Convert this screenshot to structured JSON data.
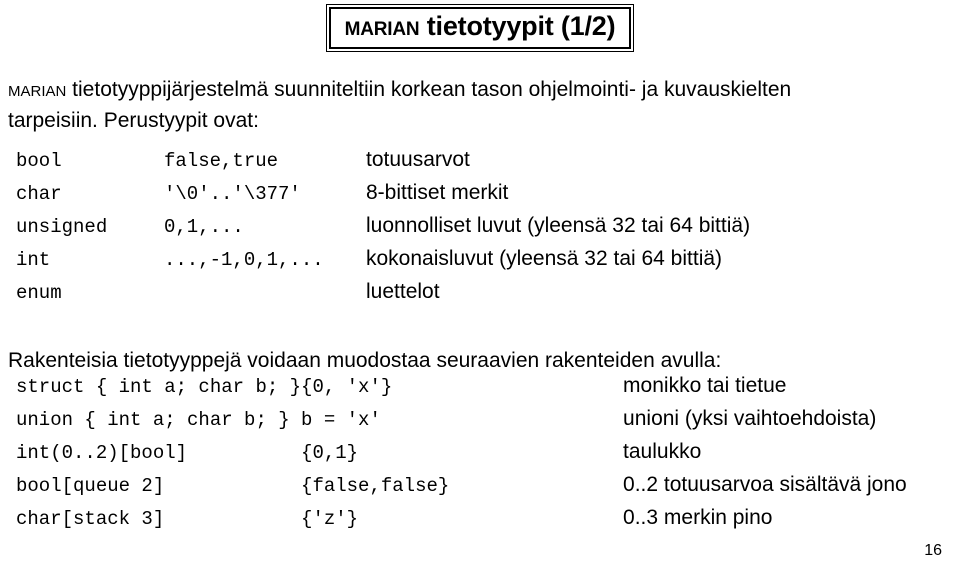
{
  "slide": {
    "title_smallcaps": "Marian",
    "title_rest": " tietotyypit (1/2)",
    "page_number": "16"
  },
  "intro": {
    "smallcaps_word": "Marian",
    "line1_rest": " tietotyyppijärjestelmä suunniteltiin korkean tason ohjelmointi- ja kuvauskielten",
    "line2": "tarpeisiin. Perustyypit ovat:"
  },
  "basic_types": {
    "rows": [
      {
        "type": "bool",
        "values": "false,true",
        "description": "totuusarvot"
      },
      {
        "type": "char",
        "values": "'\\0'..'\\377'",
        "description": "8-bittiset merkit"
      },
      {
        "type": "unsigned",
        "values": "0,1,...",
        "description": "luonnolliset luvut (yleensä 32 tai 64 bittiä)"
      },
      {
        "type": "int",
        "values": "...,-1,0,1,...",
        "description": "kokonaisluvut (yleensä 32 tai 64 bittiä)"
      },
      {
        "type": "enum",
        "values": "",
        "description": "luettelot"
      }
    ]
  },
  "composite_intro": "Rakenteisia tietotyyppejä voidaan muodostaa seuraavien rakenteiden avulla:",
  "composite_types": {
    "rows": [
      {
        "type": "struct { int a; char b; }",
        "values": "{0, 'x'}",
        "description": "monikko tai tietue"
      },
      {
        "type": "union { int a; char b; }",
        "values": "b = 'x'",
        "description": "unioni (yksi vaihtoehdoista)"
      },
      {
        "type": "int(0..2)[bool]",
        "values": "{0,1}",
        "description": "taulukko"
      },
      {
        "type": "bool[queue 2]",
        "values": "{false,false}",
        "description": "0..2 totuusarvoa sisältävä jono"
      },
      {
        "type": "char[stack 3]",
        "values": "{'z'}",
        "description": "0..3 merkin pino"
      }
    ]
  }
}
